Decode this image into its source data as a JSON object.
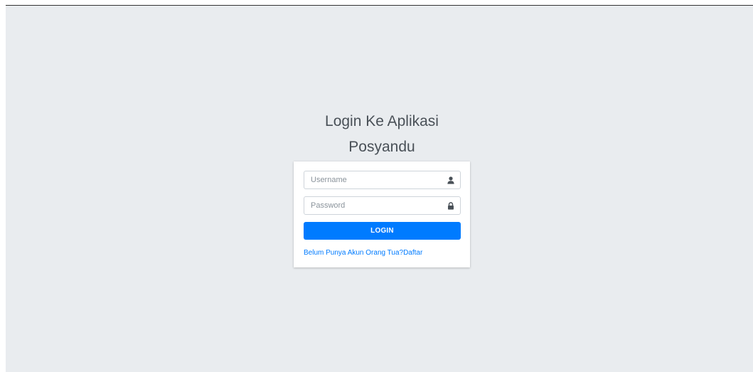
{
  "login": {
    "title_line1": "Login Ke Aplikasi",
    "title_line2": "Posyandu",
    "username": {
      "placeholder": "Username",
      "value": "",
      "icon": "user-icon"
    },
    "password": {
      "placeholder": "Password",
      "value": "",
      "icon": "lock-icon"
    },
    "submit_label": "LOGIN",
    "register_link": "Belum Punya Akun Orang Tua?Daftar"
  },
  "colors": {
    "background": "#e9ecef",
    "primary": "#007bff",
    "icon": "#495057"
  }
}
